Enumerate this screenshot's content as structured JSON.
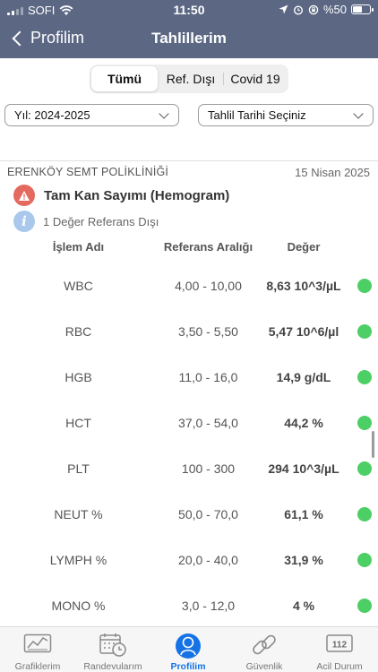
{
  "status_bar": {
    "carrier": "SOFI",
    "time": "11:50",
    "battery": "%50"
  },
  "nav": {
    "back_label": "Profilim",
    "title": "Tahlillerim"
  },
  "segments": [
    "Tümü",
    "Ref. Dışı",
    "Covid 19"
  ],
  "filters": {
    "year": "Yıl: 2024-2025",
    "date": "Tahlil Tarihi Seçiniz"
  },
  "result": {
    "clinic": "ERENKÖY SEMT POLİKLİNİĞİ",
    "date": "15 Nisan 2025",
    "test_name": "Tam Kan Sayımı (Hemogram)",
    "out_of_range_note": "1 Değer Referans Dışı",
    "columns": [
      "İşlem Adı",
      "Referans Aralığı",
      "Değer"
    ],
    "rows": [
      {
        "name": "WBC",
        "range": "4,00 - 10,00",
        "value": "8,63 10^3/µL"
      },
      {
        "name": "RBC",
        "range": "3,50 - 5,50",
        "value": "5,47 10^6/µl"
      },
      {
        "name": "HGB",
        "range": "11,0 - 16,0",
        "value": "14,9 g/dL"
      },
      {
        "name": "HCT",
        "range": "37,0 - 54,0",
        "value": "44,2 %"
      },
      {
        "name": "PLT",
        "range": "100 - 300",
        "value": "294 10^3/µL"
      },
      {
        "name": "NEUT %",
        "range": "50,0 - 70,0",
        "value": "61,1 %"
      },
      {
        "name": "LYMPH %",
        "range": "20,0 - 40,0",
        "value": "31,9 %"
      },
      {
        "name": "MONO %",
        "range": "3,0 - 12,0",
        "value": "4 %"
      }
    ]
  },
  "tabs": [
    {
      "label": "Grafiklerim",
      "icon": "chart-icon"
    },
    {
      "label": "Randevularım",
      "icon": "calendar-clock-icon"
    },
    {
      "label": "Profilim",
      "icon": "person-icon"
    },
    {
      "label": "Güvenlik",
      "icon": "link-icon"
    },
    {
      "label": "Acil Durum",
      "icon": "emergency-112-icon"
    }
  ],
  "colors": {
    "header": "#5b6783",
    "status_ok": "#4ccf65",
    "warning": "#e46a60",
    "info": "#a9c8ec",
    "tab_active": "#1673e6"
  }
}
